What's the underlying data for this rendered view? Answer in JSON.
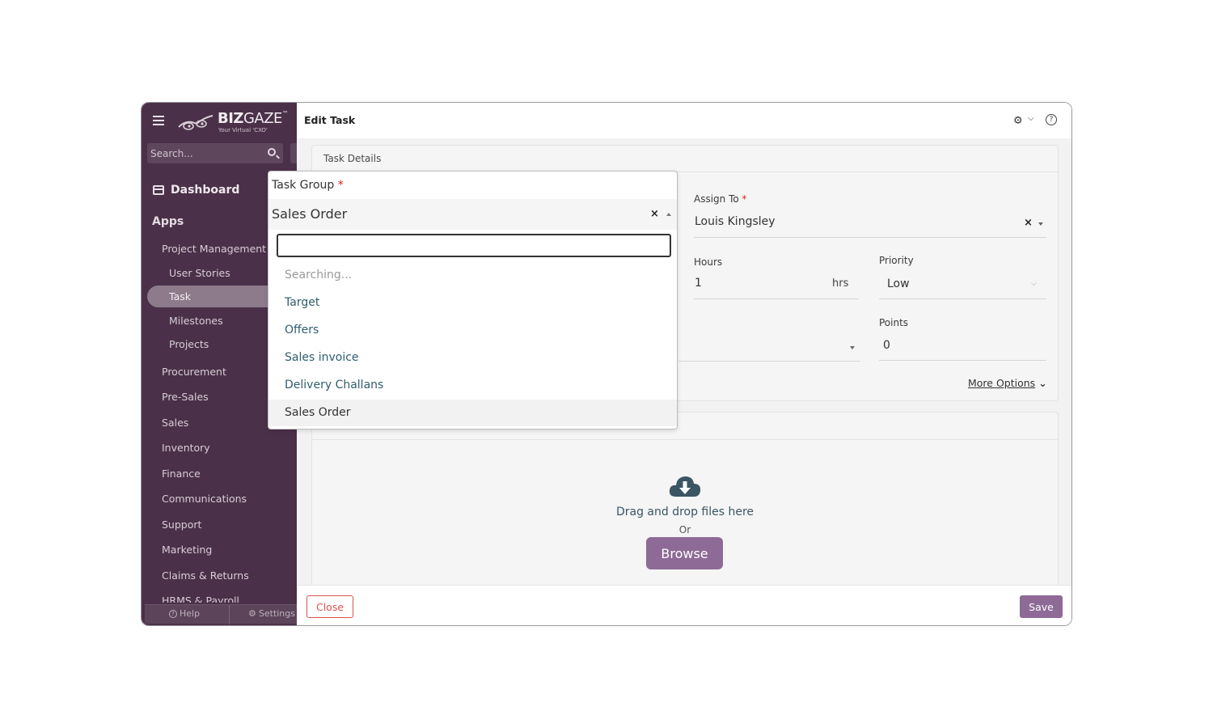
{
  "app": {
    "logo_text_bold": "BIZ",
    "logo_text_thin": "GAZE",
    "logo_tm": "™",
    "logo_sub": "Your Virtual 'CXO'",
    "brand_color": "#4a3149",
    "accent_color": "#8e6a97"
  },
  "sidebar": {
    "search_placeholder": "Search...",
    "dashboard": "Dashboard",
    "apps": "Apps",
    "items": [
      {
        "label": "Project Management",
        "level": "group"
      },
      {
        "label": "User Stories",
        "level": "sub"
      },
      {
        "label": "Task",
        "level": "sub",
        "active": true
      },
      {
        "label": "Milestones",
        "level": "sub"
      },
      {
        "label": "Projects",
        "level": "sub"
      },
      {
        "label": "Procurement",
        "level": "group"
      },
      {
        "label": "Pre-Sales",
        "level": "group"
      },
      {
        "label": "Sales",
        "level": "group"
      },
      {
        "label": "Inventory",
        "level": "group"
      },
      {
        "label": "Finance",
        "level": "group"
      },
      {
        "label": "Communications",
        "level": "group"
      },
      {
        "label": "Support",
        "level": "group"
      },
      {
        "label": "Marketing",
        "level": "group"
      },
      {
        "label": "Claims & Returns",
        "level": "group"
      },
      {
        "label": "HRMS & Payroll",
        "level": "group"
      }
    ],
    "help": "Help",
    "settings": "Settings"
  },
  "header": {
    "title": "Edit Task",
    "gear_icon": "gear-icon",
    "help_icon": "question-circle-icon"
  },
  "task_details": {
    "section_title": "Task Details",
    "assign_to_label": "Assign To",
    "assign_to_value": "Louis Kingsley",
    "hours_label": "Hours",
    "hours_value": "1",
    "hours_unit": "hrs",
    "priority_label": "Priority",
    "priority_value": "Low",
    "points_label": "Points",
    "points_value": "0",
    "more_options": "More Options"
  },
  "attachments": {
    "drag_text": "Drag and drop files here",
    "or_text": "Or",
    "browse_label": "Browse"
  },
  "footer": {
    "close_label": "Close",
    "save_label": "Save"
  },
  "dropdown": {
    "label": "Task Group",
    "selected": "Sales Order",
    "search_value": "",
    "searching_text": "Searching...",
    "options": [
      "Target",
      "Offers",
      "Sales invoice",
      "Delivery Challans",
      "Sales Order"
    ],
    "highlighted": "Sales Order"
  }
}
